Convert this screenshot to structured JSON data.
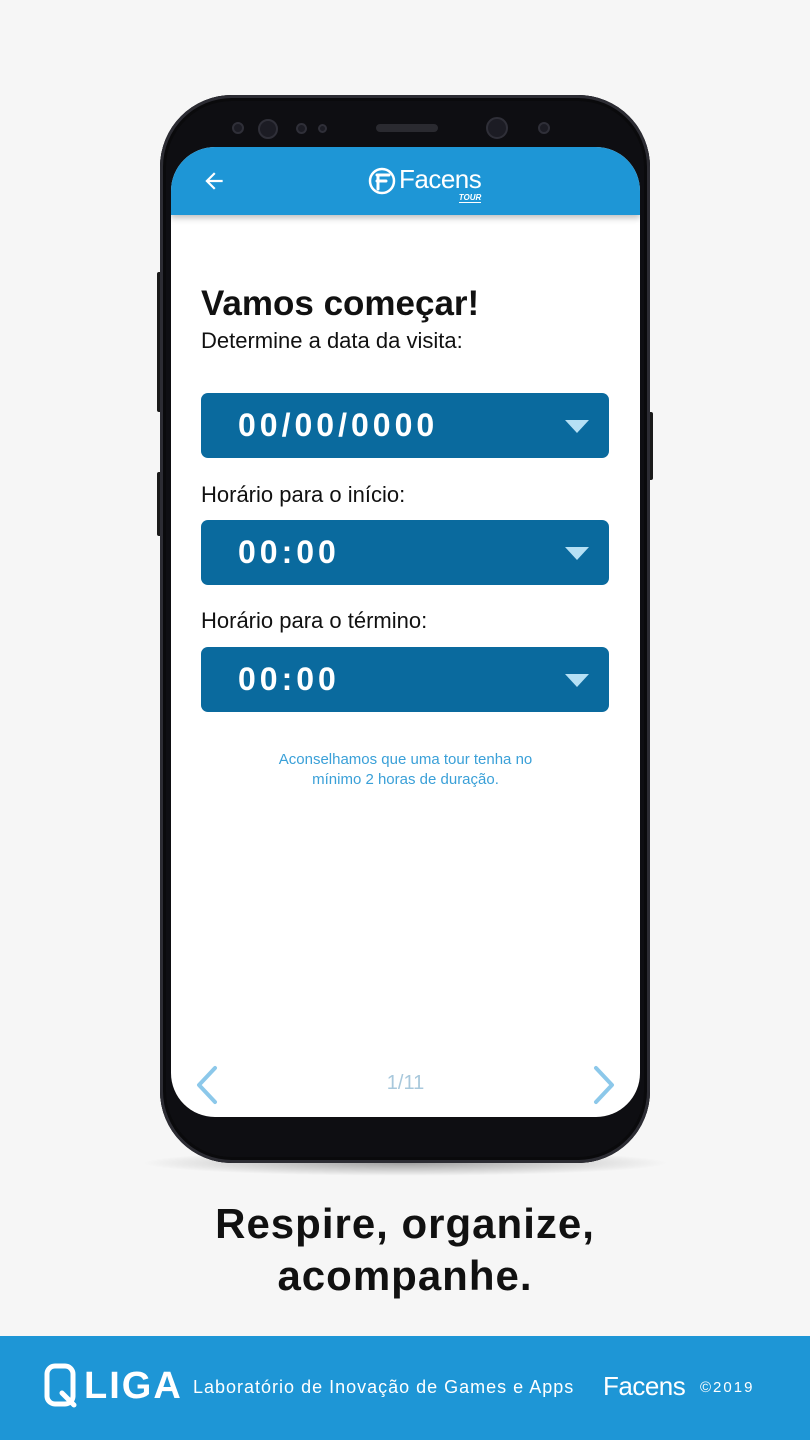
{
  "app": {
    "brand": "Facens",
    "brand_sub": "TOUR"
  },
  "form": {
    "heading": "Vamos começar!",
    "subheading": "Determine a data da visita:",
    "date_value": "00/00/0000",
    "start_label": "Horário para o início:",
    "start_value": "00:00",
    "end_label": "Horário para o término:",
    "end_value": "00:00",
    "hint_line1": "Aconselhamos que uma tour tenha no",
    "hint_line2": "mínimo 2 horas de duração."
  },
  "pager": {
    "indicator": "1/11"
  },
  "promo": {
    "line1": "Respire, organize,",
    "line2": "acompanhe."
  },
  "footer": {
    "liga": "LIGA",
    "text": "Laboratório de Inovação de Games e Apps",
    "brand": "Facens",
    "copyright": "©2019"
  },
  "colors": {
    "appbar": "#1e96d6",
    "select": "#0a6a9e",
    "hint": "#3aa0d8",
    "footer": "#1e96d6"
  },
  "icons": [
    "back-arrow-icon",
    "caret-down-icon",
    "chevron-left-icon",
    "chevron-right-icon"
  ]
}
